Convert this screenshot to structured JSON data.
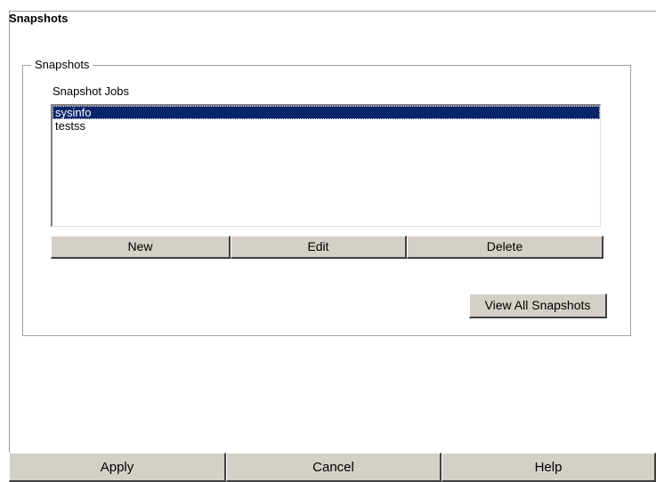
{
  "panel": {
    "title": "Snapshots"
  },
  "group": {
    "legend": "Snapshots",
    "jobs_label": "Snapshot Jobs",
    "jobs": [
      {
        "name": "sysinfo",
        "selected": true
      },
      {
        "name": "testss",
        "selected": false
      }
    ],
    "buttons": {
      "new": "New",
      "edit": "Edit",
      "delete": "Delete",
      "view_all": "View All Snapshots"
    }
  },
  "footer": {
    "apply": "Apply",
    "cancel": "Cancel",
    "help": "Help"
  },
  "colors": {
    "selection": "#0a246a",
    "button_face": "#d4d0c8"
  }
}
